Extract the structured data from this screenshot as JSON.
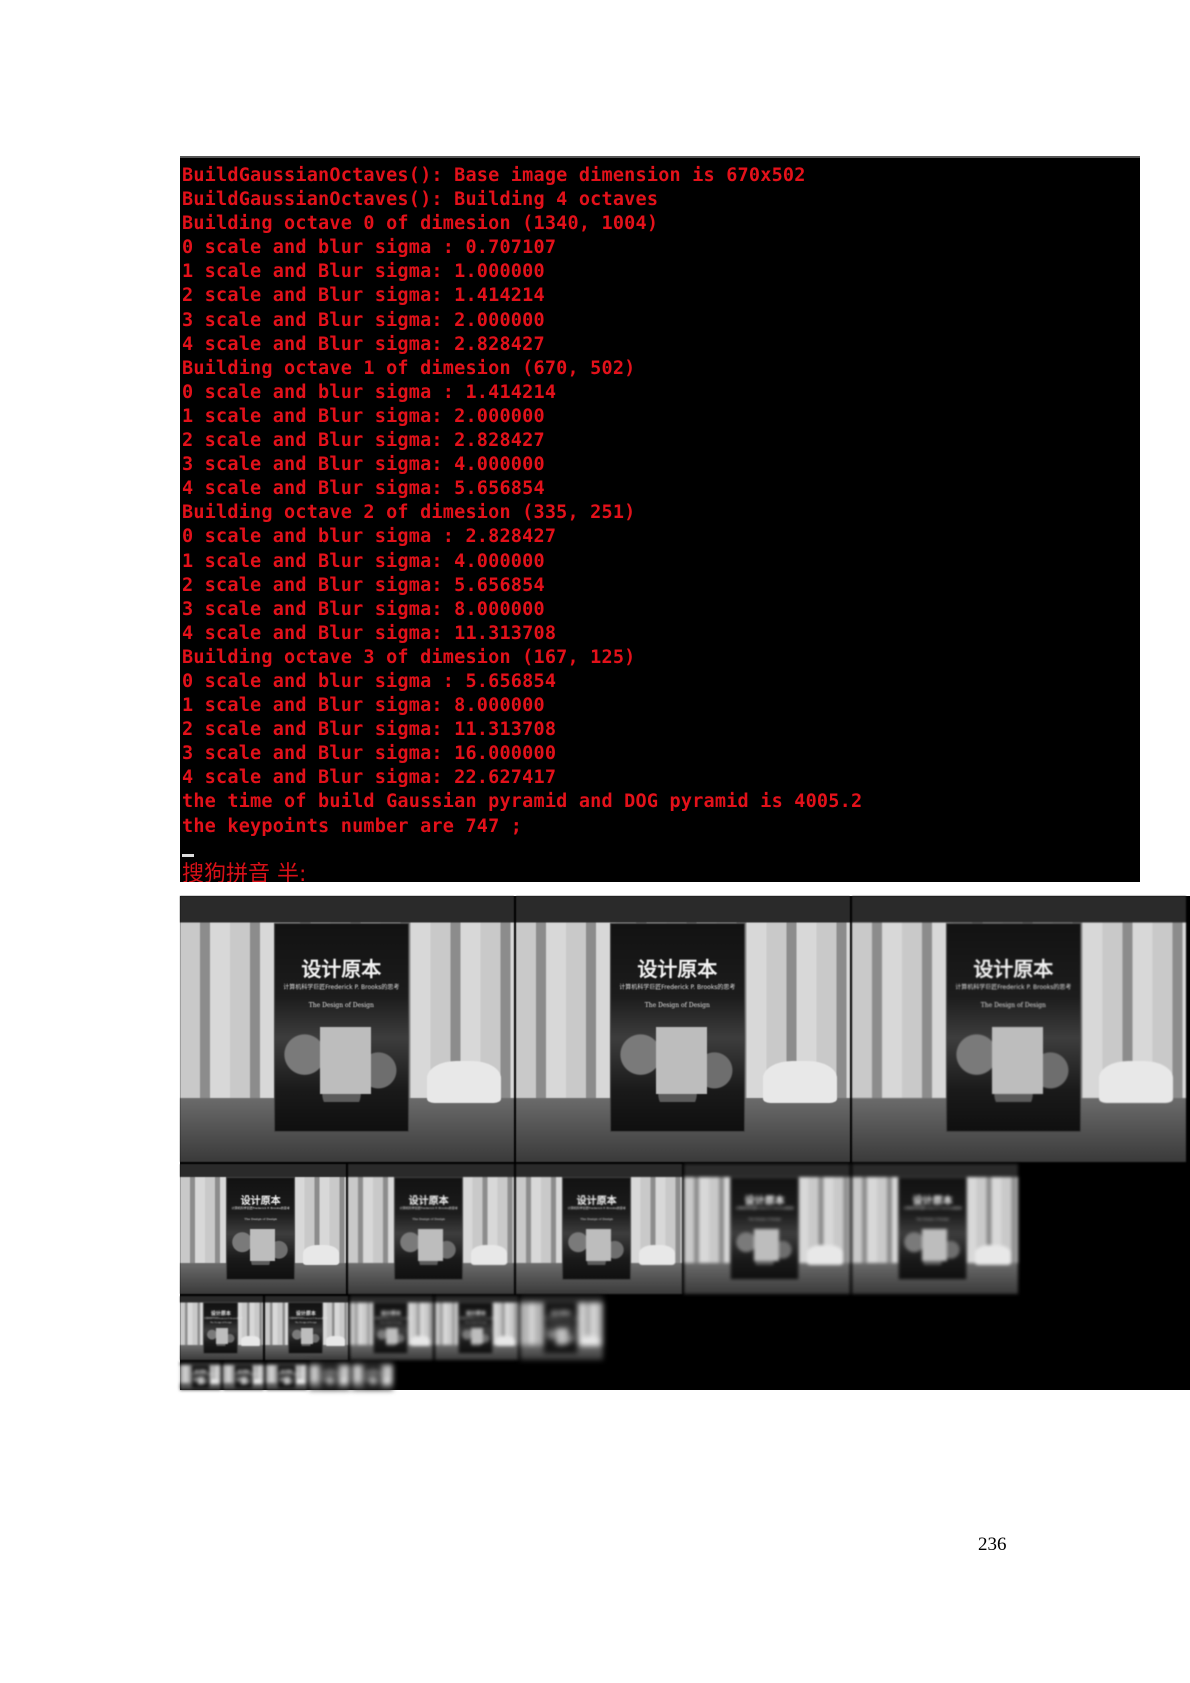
{
  "console": {
    "lines": [
      "BuildGaussianOctaves(): Base image dimension is 670x502",
      "BuildGaussianOctaves(): Building 4 octaves",
      "Building octave 0 of dimesion (1340, 1004)",
      "0 scale and blur sigma : 0.707107",
      "1 scale and Blur sigma: 1.000000",
      "2 scale and Blur sigma: 1.414214",
      "3 scale and Blur sigma: 2.000000",
      "4 scale and Blur sigma: 2.828427",
      "Building octave 1 of dimesion (670, 502)",
      "0 scale and blur sigma : 1.414214",
      "1 scale and Blur sigma: 2.000000",
      "2 scale and Blur sigma: 2.828427",
      "3 scale and Blur sigma: 4.000000",
      "4 scale and Blur sigma: 5.656854",
      "Building octave 2 of dimesion (335, 251)",
      "0 scale and blur sigma : 2.828427",
      "1 scale and Blur sigma: 4.000000",
      "2 scale and Blur sigma: 5.656854",
      "3 scale and Blur sigma: 8.000000",
      "4 scale and Blur sigma: 11.313708",
      "Building octave 3 of dimesion (167, 125)",
      "0 scale and blur sigma : 5.656854",
      "1 scale and Blur sigma: 8.000000",
      "2 scale and Blur sigma: 11.313708",
      "3 scale and Blur sigma: 16.000000",
      "4 scale and Blur sigma: 22.627417",
      "the time of build Gaussian pyramid and DOG pyramid is 4005.2",
      "the keypoints number are 747 ;"
    ],
    "ime_status": "搜狗拼音 半:",
    "text_color": "#e3111a"
  },
  "pyramid": {
    "book_title": "设计原本",
    "book_subtitle": "计算机科学巨匠Frederick P. Brooks的思考",
    "book_english": "The Design of Design"
  },
  "page_number": "236"
}
